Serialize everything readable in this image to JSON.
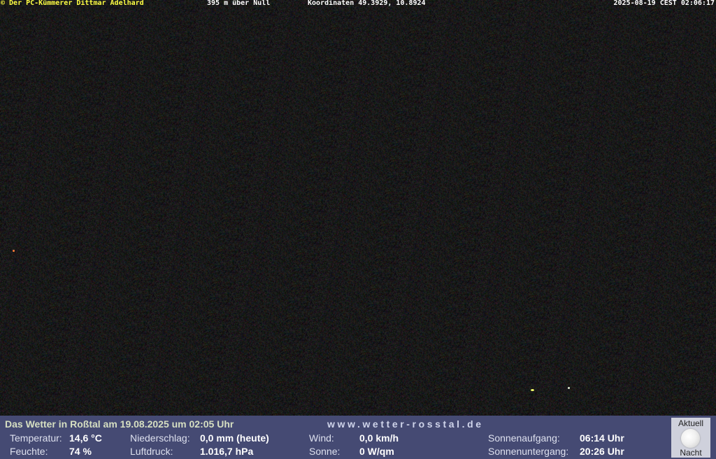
{
  "overlay": {
    "copyright": "© Der PC-Kümmerer Dittmar Adelhard",
    "altitude": "395 m über Null",
    "coordinates": "Koordinaten 49.3929, 10.8924",
    "datetime": "2025-08-19 CEST 02:06:17"
  },
  "weather": {
    "title": "Das Wetter in Roßtal am 19.08.2025 um 02:05 Uhr",
    "website": "www.wetter-rosstal.de",
    "temperature": {
      "label": "Temperatur:",
      "value": "14,6 °C"
    },
    "humidity": {
      "label": "Feuchte:",
      "value": "74 %"
    },
    "precipitation": {
      "label": "Niederschlag:",
      "value": "0,0 mm (heute)"
    },
    "pressure": {
      "label": "Luftdruck:",
      "value": "1.016,7 hPa"
    },
    "wind": {
      "label": "Wind:",
      "value": "0,0 km/h"
    },
    "sun": {
      "label": "Sonne:",
      "value": "0 W/qm"
    },
    "sunrise": {
      "label": "Sonnenaufgang:",
      "value": "06:14 Uhr"
    },
    "sunset": {
      "label": "Sonnenuntergang:",
      "value": "20:26 Uhr"
    },
    "moon": {
      "top_label": "Aktuell",
      "bottom_label": "Nacht",
      "icon": "full-moon-icon"
    }
  },
  "colors": {
    "panel_background": "#454a73",
    "overlay_copyright": "#ffff44",
    "overlay_text": "#ffffff",
    "sky": "#151515"
  }
}
